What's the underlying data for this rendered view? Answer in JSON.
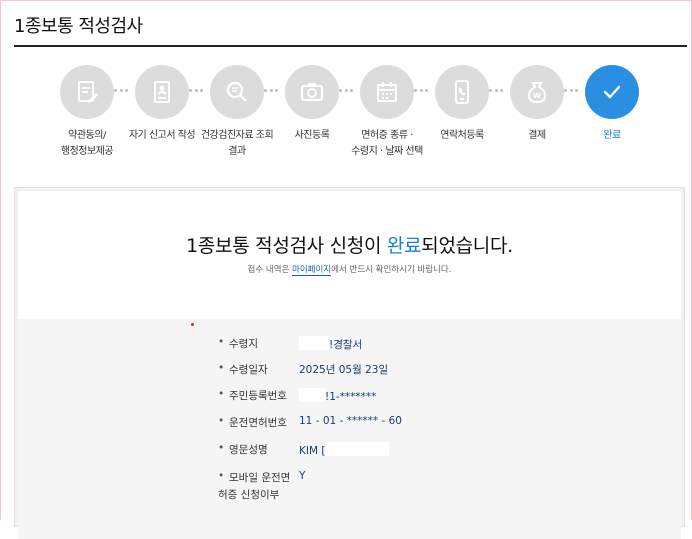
{
  "header": {
    "title": "1종보통 적성검사"
  },
  "steps": [
    {
      "label_line1": "약관동의/",
      "label_line2": "행정정보제공",
      "icon": "document-edit-icon",
      "active": false
    },
    {
      "label_line1": "자기 신고서 작성",
      "label_line2": "",
      "icon": "id-card-icon",
      "active": false
    },
    {
      "label_line1": "건강검진자료 조회",
      "label_line2": "결과",
      "icon": "search-doc-icon",
      "active": false
    },
    {
      "label_line1": "사진등록",
      "label_line2": "",
      "icon": "camera-icon",
      "active": false
    },
    {
      "label_line1": "면허증 종류 ·",
      "label_line2": "수령지 · 날짜 선택",
      "icon": "calendar-icon",
      "active": false
    },
    {
      "label_line1": "연락처등록",
      "label_line2": "",
      "icon": "mobile-phone-icon",
      "active": false
    },
    {
      "label_line1": "결제",
      "label_line2": "",
      "icon": "won-payment-icon",
      "active": false
    },
    {
      "label_line1": "완료",
      "label_line2": "",
      "icon": "check-icon",
      "active": true
    }
  ],
  "completion": {
    "title_prefix": "1종보통 적성검사 신청이 ",
    "title_highlight": "완료",
    "title_suffix": "되었습니다.",
    "notice_prefix": "접수 내역은 ",
    "notice_link": "마이페이지",
    "notice_suffix": "에서 반드시 확인하시기 바랍니다."
  },
  "info": {
    "bullet": "•",
    "rows": [
      {
        "label": "수령지",
        "value": "!경찰서"
      },
      {
        "label": "수령일자",
        "value": "2025년 05월 23일"
      },
      {
        "label": "주민등록번호",
        "value": "!1-*******"
      },
      {
        "label": "운전면허번호",
        "value": "11 - 01 - ****** - 60"
      },
      {
        "label": "영문성명",
        "value": "KIM ["
      },
      {
        "label_line1": "모바일 운전면",
        "label_line2": "허증 신청이부",
        "value": "Y"
      }
    ]
  },
  "colors": {
    "accent": "#2a8fe0",
    "step_inactive": "#dcdcdc",
    "value_text": "#1a3d70"
  }
}
